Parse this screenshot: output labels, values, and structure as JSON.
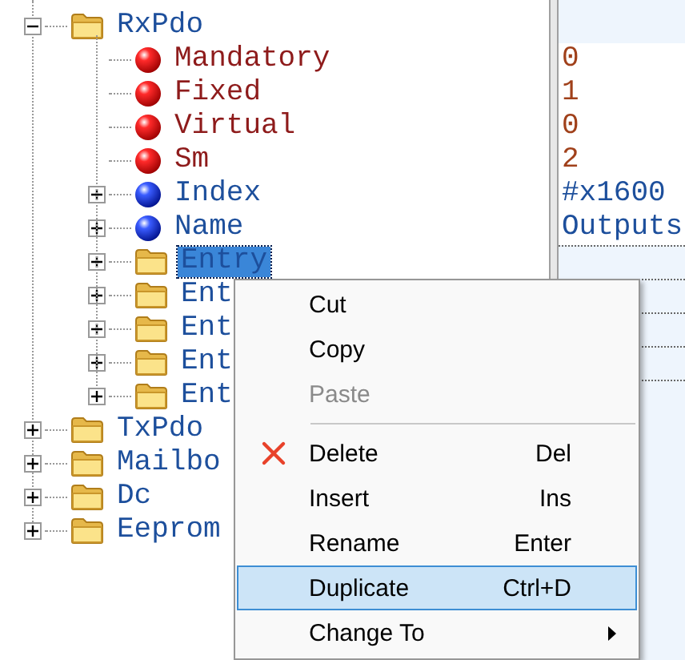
{
  "tree": [
    {
      "label": "RxPdo",
      "kind": "folder",
      "expanded": true,
      "selected": false,
      "children": [
        {
          "label": "Mandatory",
          "kind": "attribute",
          "value": "0",
          "selected": false
        },
        {
          "label": "Fixed",
          "kind": "attribute",
          "value": "1",
          "selected": false
        },
        {
          "label": "Virtual",
          "kind": "attribute",
          "value": "0",
          "selected": false
        },
        {
          "label": "Sm",
          "kind": "attribute",
          "value": "2",
          "selected": false
        },
        {
          "label": "Index",
          "kind": "element",
          "expanded": false,
          "value": "#x1600",
          "selected": false
        },
        {
          "label": "Name",
          "kind": "element",
          "expanded": false,
          "value": "Outputs",
          "selected": false
        },
        {
          "label": "Entry",
          "kind": "folder",
          "expanded": false,
          "selected": true
        },
        {
          "label": "Ent",
          "kind": "folder",
          "expanded": false,
          "selected": false
        },
        {
          "label": "Ent",
          "kind": "folder",
          "expanded": false,
          "selected": false
        },
        {
          "label": "Ent",
          "kind": "folder",
          "expanded": false,
          "selected": false
        },
        {
          "label": "Ent",
          "kind": "folder",
          "expanded": false,
          "selected": false
        }
      ]
    },
    {
      "label": "TxPdo",
      "kind": "folder",
      "expanded": false,
      "selected": false
    },
    {
      "label": "Mailbo",
      "kind": "folder",
      "expanded": false,
      "selected": false
    },
    {
      "label": "Dc",
      "kind": "folder",
      "expanded": false,
      "selected": false
    },
    {
      "label": "Eeprom",
      "kind": "folder",
      "expanded": false,
      "selected": false
    }
  ],
  "context_menu": [
    {
      "kind": "item",
      "label": "Cut",
      "disabled": false,
      "selected": false
    },
    {
      "kind": "item",
      "label": "Copy",
      "disabled": false,
      "selected": false
    },
    {
      "kind": "item",
      "label": "Paste",
      "disabled": true,
      "selected": false
    },
    {
      "kind": "separator"
    },
    {
      "kind": "icon-item",
      "label": "Delete",
      "shortcut": "Del",
      "disabled": false,
      "selected": false
    },
    {
      "kind": "item",
      "label": "Insert",
      "shortcut": "Ins",
      "disabled": false,
      "selected": false
    },
    {
      "kind": "item",
      "label": "Rename",
      "shortcut": "Enter",
      "disabled": false,
      "selected": false
    },
    {
      "kind": "item",
      "label": "Duplicate",
      "shortcut": "Ctrl+D",
      "disabled": false,
      "selected": true
    },
    {
      "kind": "submenu",
      "label": "Change To",
      "disabled": false,
      "selected": false
    }
  ]
}
